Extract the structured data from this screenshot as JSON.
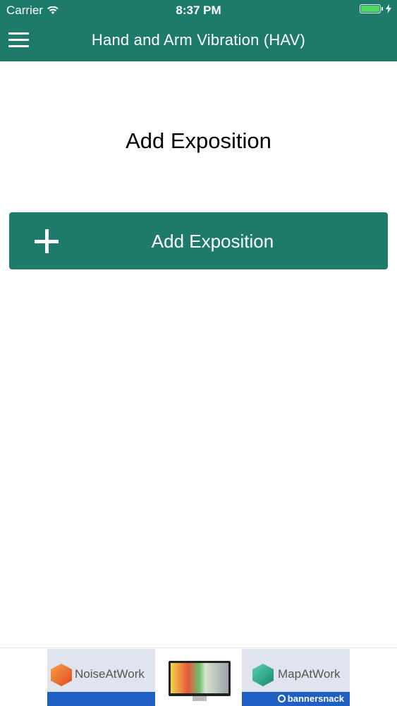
{
  "status_bar": {
    "carrier": "Carrier",
    "time": "8:37 PM",
    "battery_color": "#4cd964"
  },
  "header": {
    "title": "Hand and Arm Vibration (HAV)",
    "menu_icon": "hamburger-menu-icon",
    "background_color": "#1e7b6b"
  },
  "main": {
    "heading": "Add Exposition",
    "add_button": {
      "label": "Add Exposition",
      "icon": "plus-icon"
    }
  },
  "ad_banner": {
    "left_brand": "NoiseAtWork",
    "right_brand": "MapAtWork",
    "provider": "bannersnack"
  }
}
